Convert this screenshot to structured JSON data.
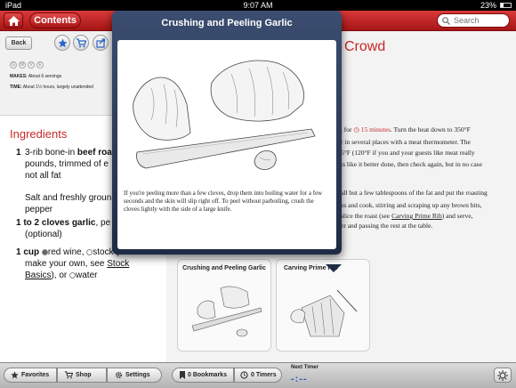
{
  "status_bar": {
    "carrier": "iPad",
    "time": "9:07 AM",
    "battery": "23%"
  },
  "nav": {
    "contents_label": "Contents",
    "search_placeholder": "Search"
  },
  "left": {
    "back_label": "Back",
    "diet_marks": [
      "G",
      "M",
      "V",
      "E"
    ],
    "makes_label": "MAKES:",
    "makes_value": "About 6 servings",
    "time_label": "TIME:",
    "time_value": "About 1½ hours, largely unattended",
    "ingredients_title": "Ingredients",
    "ingredients": [
      {
        "qty": "1",
        "line1": "3-rib bone-in ",
        "line1_bold": "beef roast",
        "line2": "pounds, trimmed of e",
        "line3": "not all fat"
      },
      {
        "line1": "Salt and freshly groun",
        "line2": "pepper"
      },
      {
        "qty": "1 to 2 cloves",
        "name": "garlic",
        "rest": ", pe",
        "line2": "(optional)"
      },
      {
        "qty": "1 cup",
        "opt1": "red wine",
        "opt2": "stock",
        "rest": " (to",
        "line2": "make your own, see ",
        "link": "Stock",
        "line3_link": "Basics",
        "line3_rest": "), or ",
        "opt3": "water"
      }
    ]
  },
  "right": {
    "title_fragment": "Crowd",
    "lines": [
      {
        "a": ", for ",
        "timer": "15 minutes",
        "b": ". Turn the heat down to 350°F"
      },
      {
        "a": "r in several places with a meat thermometer. The"
      },
      {
        "a": "5°F (120°F if you and your guests like meat really"
      },
      {
        "a": "ts like it better done, then check again, but in no case"
      },
      {
        "a": ""
      },
      {
        "a": "all but a few tablespoons of the fat and put the roasting"
      },
      {
        "a": "es and cook, stirring and scraping up any brown bits,"
      },
      {
        "a": "slice the roast (see ",
        "link": "Carving Prime Rib",
        "b": ") and serve,"
      },
      {
        "a": "er and passing the rest at the table."
      }
    ],
    "thumbs": [
      {
        "caption": "Crushing and Peeling Garlic"
      },
      {
        "caption": "Carving Prime Rib"
      }
    ]
  },
  "popover": {
    "title": "Crushing and Peeling Garlic",
    "caption": "If you're peeling more than a few cloves, drop them into boiling water for a few seconds and the skin will slip right off. To peel without parboiling, crush the cloves lightly with the side of a large knife."
  },
  "toolbar": {
    "favorites": "Favorites",
    "shop": "Shop",
    "settings": "Settings",
    "bookmarks": "0 Bookmarks",
    "timers": "0 Timers",
    "next_timer_label": "Next Timer",
    "next_timer_value": "-:--"
  },
  "colors": {
    "brand_red": "#c8282a",
    "nav_red": "#b21d1d",
    "popover_blue": "#2d3c5c",
    "timer_blue": "#2b5fb4"
  }
}
